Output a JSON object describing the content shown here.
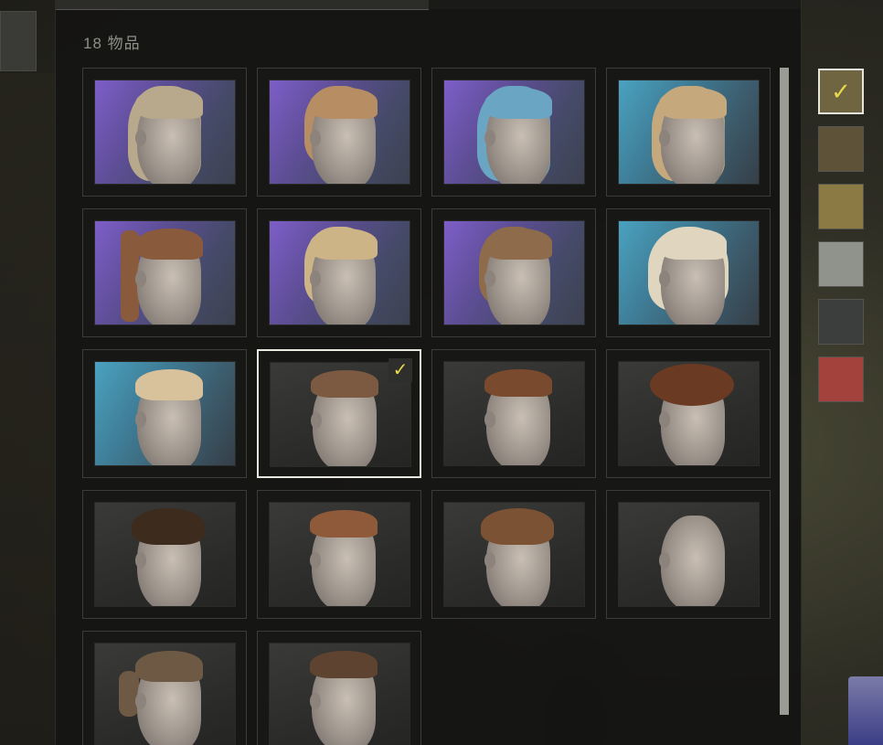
{
  "inventory": {
    "item_count_label": "18 物品"
  },
  "hair_items": [
    {
      "id": 1,
      "bg": "purple",
      "hair_color": "#b8a88c",
      "style": "long",
      "selected": false
    },
    {
      "id": 2,
      "bg": "purple",
      "hair_color": "#b78d63",
      "style": "medium",
      "selected": false
    },
    {
      "id": 3,
      "bg": "purple",
      "hair_color": "#6aa6c4",
      "style": "long",
      "selected": false
    },
    {
      "id": 4,
      "bg": "blue",
      "hair_color": "#c5a97d",
      "style": "long",
      "selected": false
    },
    {
      "id": 5,
      "bg": "purple",
      "hair_color": "#8a5a3c",
      "style": "braid",
      "selected": false
    },
    {
      "id": 6,
      "bg": "purple",
      "hair_color": "#cdb487",
      "style": "medium",
      "selected": false
    },
    {
      "id": 7,
      "bg": "purple",
      "hair_color": "#8d6b4b",
      "style": "medium",
      "selected": false
    },
    {
      "id": 8,
      "bg": "blue",
      "hair_color": "#e0d6bf",
      "style": "bob",
      "selected": false
    },
    {
      "id": 9,
      "bg": "blue",
      "hair_color": "#d7c29b",
      "style": "bun",
      "selected": false
    },
    {
      "id": 10,
      "bg": "dark",
      "hair_color": "#7c5a42",
      "style": "short",
      "selected": true
    },
    {
      "id": 11,
      "bg": "dark",
      "hair_color": "#7a4a2e",
      "style": "short",
      "selected": false
    },
    {
      "id": 12,
      "bg": "dark",
      "hair_color": "#6b3a22",
      "style": "afro",
      "selected": false
    },
    {
      "id": 13,
      "bg": "dark",
      "hair_color": "#3d2b1d",
      "style": "curly",
      "selected": false
    },
    {
      "id": 14,
      "bg": "dark",
      "hair_color": "#8e5a3a",
      "style": "undercut",
      "selected": false
    },
    {
      "id": 15,
      "bg": "dark",
      "hair_color": "#7c5234",
      "style": "wavy",
      "selected": false
    },
    {
      "id": 16,
      "bg": "dark",
      "hair_color": "#b89a8a",
      "style": "bald",
      "selected": false
    },
    {
      "id": 17,
      "bg": "dark",
      "hair_color": "#6e5a44",
      "style": "ponytail",
      "selected": false
    },
    {
      "id": 18,
      "bg": "dark",
      "hair_color": "#5e4430",
      "style": "short",
      "selected": false
    }
  ],
  "color_swatches": [
    {
      "name": "swatch-dark-khaki",
      "color": "#6f6540",
      "selected": true
    },
    {
      "name": "swatch-olive-brown",
      "color": "#5e5238",
      "selected": false
    },
    {
      "name": "swatch-golden-tan",
      "color": "#8c7a44",
      "selected": false
    },
    {
      "name": "swatch-light-gray",
      "color": "#8f938c",
      "selected": false
    },
    {
      "name": "swatch-charcoal",
      "color": "#3c3e3e",
      "selected": false
    },
    {
      "name": "swatch-red",
      "color": "#a3423c",
      "selected": false
    }
  ],
  "icons": {
    "selected_check": "✓"
  }
}
